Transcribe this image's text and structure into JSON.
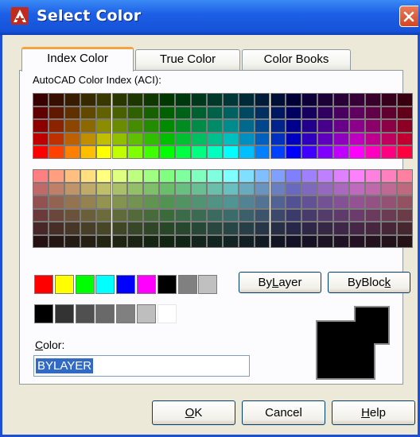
{
  "window": {
    "title": "Select Color"
  },
  "tabs": [
    {
      "label": "Index Color",
      "active": true
    },
    {
      "label": "True Color",
      "active": false
    },
    {
      "label": "Color Books",
      "active": false
    }
  ],
  "index_tab": {
    "aci_label": "AutoCAD Color Index (ACI):",
    "standard_colors": [
      "#ff0000",
      "#ffff00",
      "#00ff00",
      "#00ffff",
      "#0000ff",
      "#ff00ff",
      "#000000",
      "#808080",
      "#c0c0c0"
    ],
    "gray_colors": [
      "#000000",
      "#333333",
      "#505050",
      "#696969",
      "#808080",
      "#bebebe",
      "#ffffff"
    ],
    "bylayer_button": {
      "pre": "By",
      "key": "L",
      "post": "ayer"
    },
    "byblock_button": {
      "pre": "ByBloc",
      "key": "k",
      "post": ""
    },
    "color_label": {
      "key": "C",
      "rest": "olor:"
    },
    "color_value": "BYLAYER",
    "preview_color": "#000000"
  },
  "footer": {
    "ok": {
      "pre": "",
      "key": "O",
      "post": "K"
    },
    "cancel": {
      "pre": "Cancel",
      "key": "",
      "post": ""
    },
    "help": {
      "pre": "",
      "key": "H",
      "post": "elp"
    }
  },
  "colors": {
    "title_bar": "#1c5fe6",
    "active_tab_accent": "#f5a33c",
    "dialog_bg": "#ece9d8",
    "selection": "#316ac5"
  }
}
